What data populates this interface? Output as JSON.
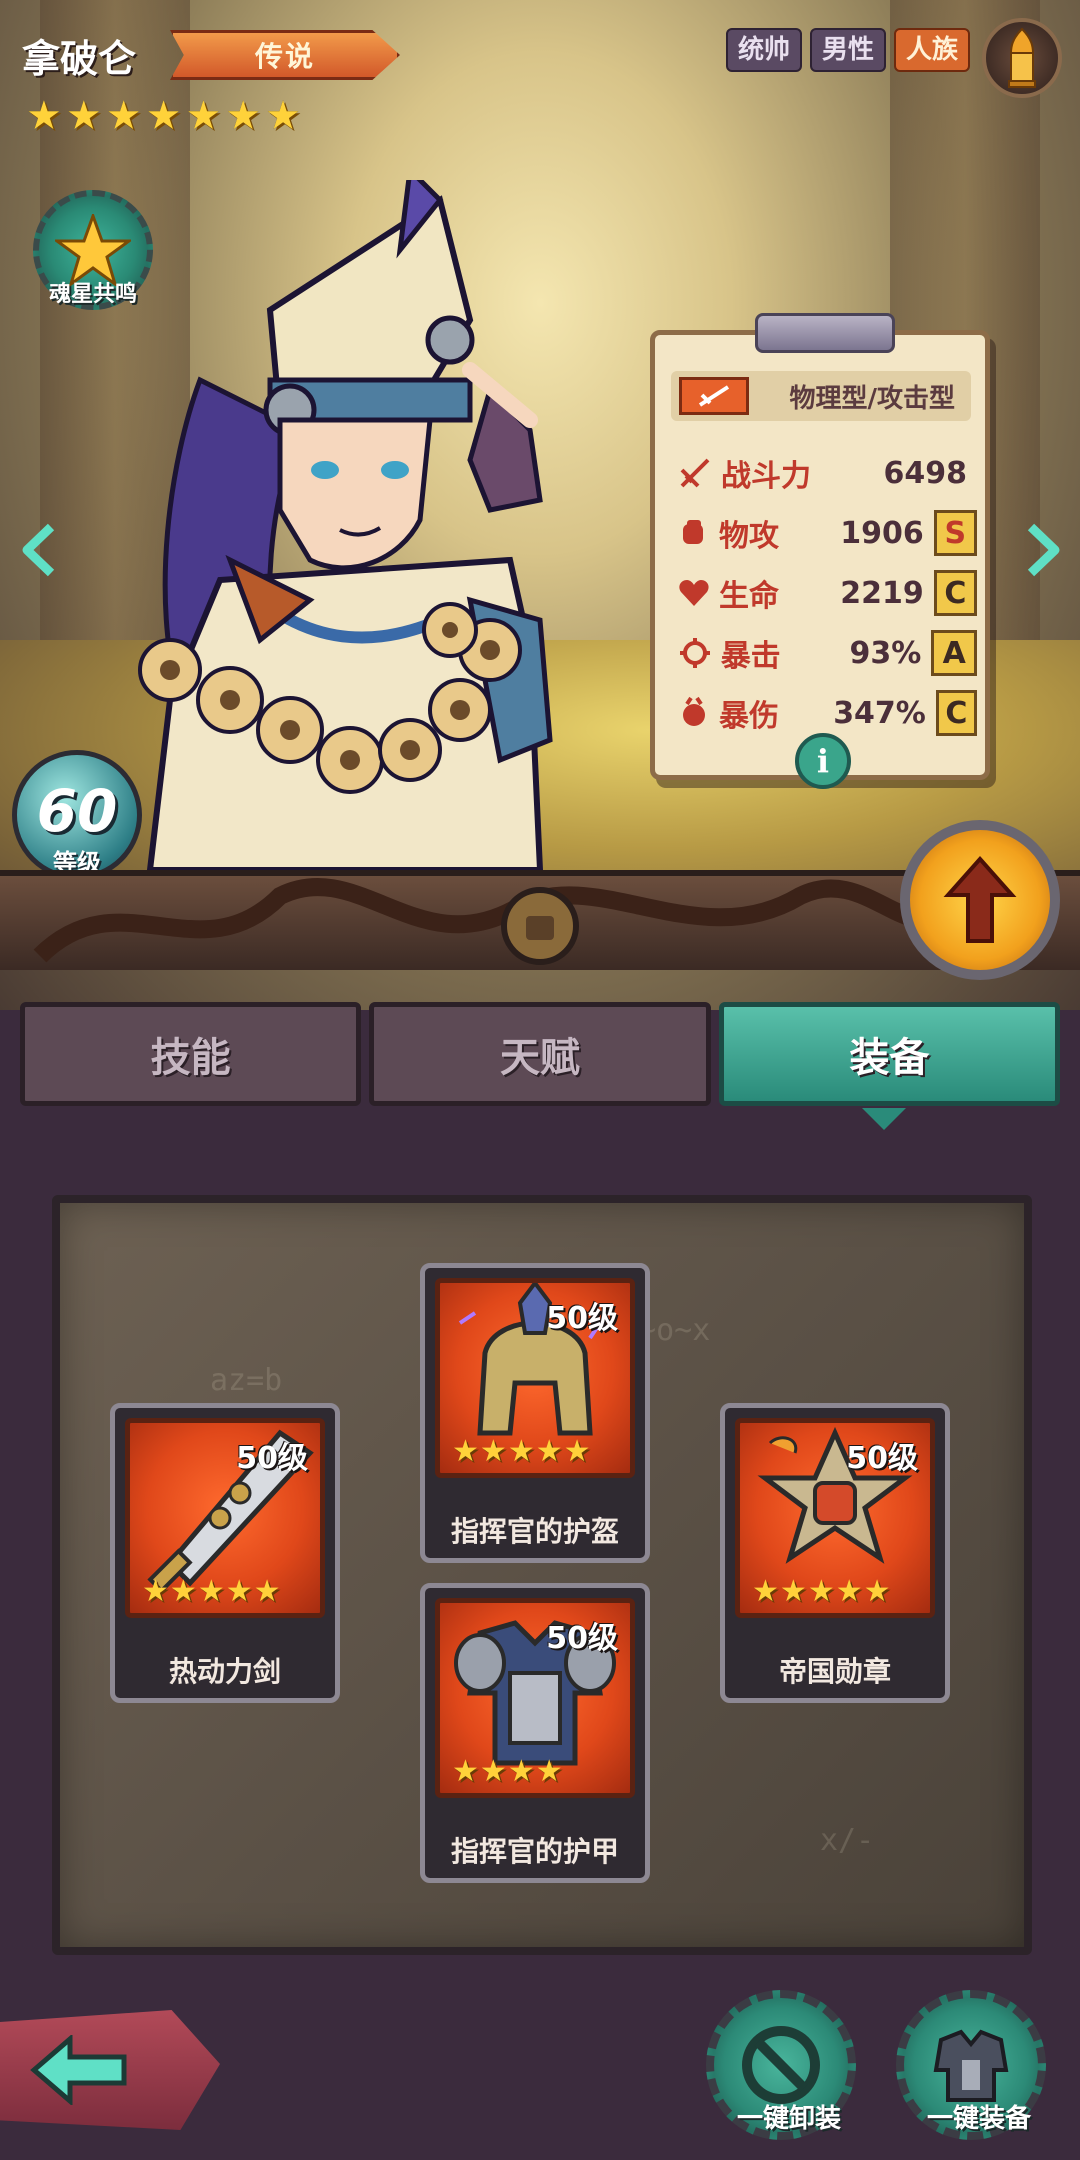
{
  "hero": {
    "name": "拿破仑",
    "rarity": "传说",
    "star_count": 7,
    "tags": [
      "统帅",
      "男性",
      "人族"
    ],
    "resonance_label": "魂星共鸣",
    "level": "60",
    "level_label": "等级"
  },
  "stats": {
    "type_label": "物理型/攻击型",
    "rows": [
      {
        "name": "战斗力",
        "value": "6498",
        "grade": "",
        "icon": "power-icon"
      },
      {
        "name": "物攻",
        "value": "1906",
        "grade": "S",
        "icon": "fist-icon"
      },
      {
        "name": "生命",
        "value": "2219",
        "grade": "C",
        "icon": "heart-icon"
      },
      {
        "name": "暴击",
        "value": "93%",
        "grade": "A",
        "icon": "crit-icon"
      },
      {
        "name": "暴伤",
        "value": "347%",
        "grade": "C",
        "icon": "crit-damage-icon"
      }
    ],
    "info_label": "i"
  },
  "tabs": [
    {
      "label": "技能",
      "active": false
    },
    {
      "label": "天赋",
      "active": false
    },
    {
      "label": "装备",
      "active": true
    }
  ],
  "equipment": [
    {
      "slot": "weapon",
      "name": "热动力剑",
      "level": "50级",
      "stars": 5
    },
    {
      "slot": "helmet",
      "name": "指挥官的护盔",
      "level": "50级",
      "stars": 5
    },
    {
      "slot": "armor",
      "name": "指挥官的护甲",
      "level": "50级",
      "stars": 4
    },
    {
      "slot": "medal",
      "name": "帝国勋章",
      "level": "50级",
      "stars": 5
    }
  ],
  "actions": {
    "unequip_all": "一键卸装",
    "equip_all": "一键装备"
  },
  "colors": {
    "accent_teal": "#2a8b7a",
    "rarity_orange": "#d2592a",
    "stat_red": "#c0392b",
    "grade_gold": "#f1c84a",
    "equipment_red": "#e0481a"
  }
}
